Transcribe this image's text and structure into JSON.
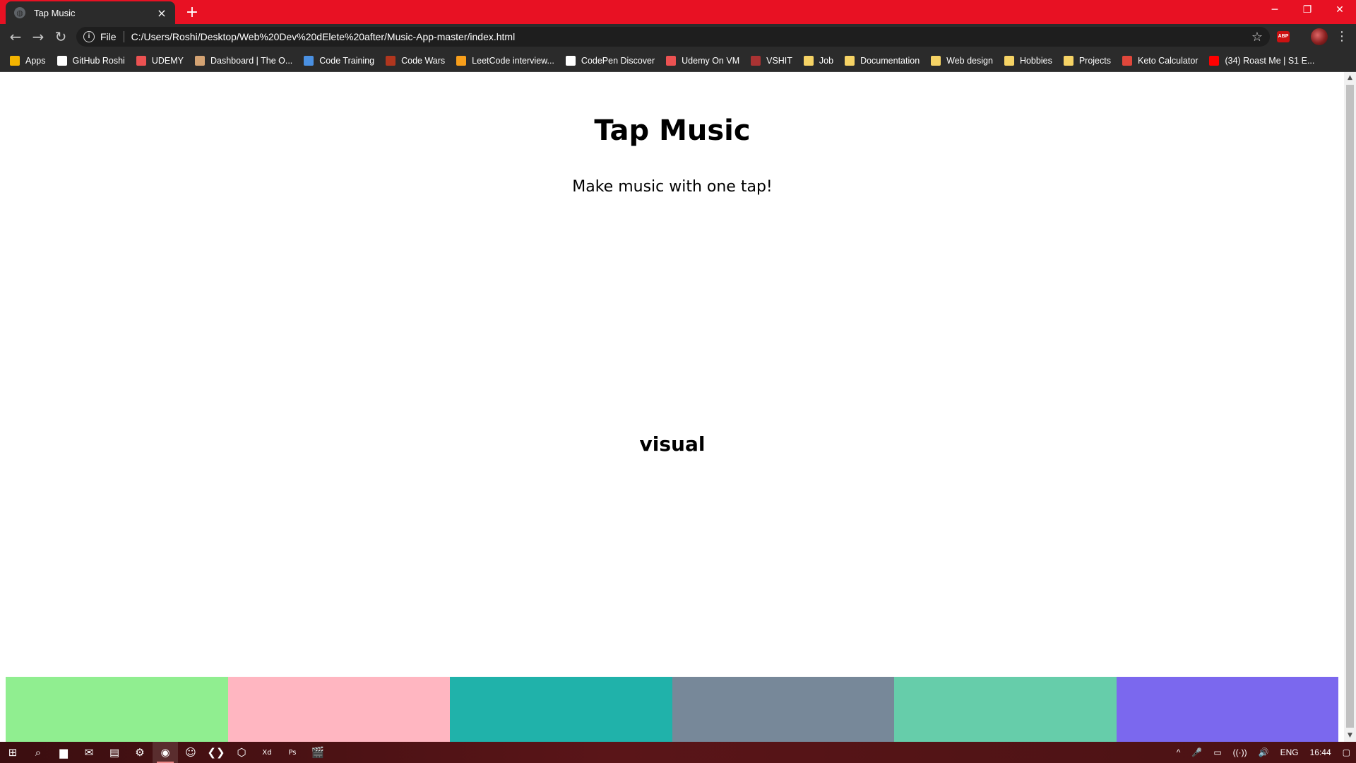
{
  "browser": {
    "tab_title": "Tap Music",
    "tab_close": "×",
    "new_tab": "+",
    "window_controls": {
      "minimize": "─",
      "restore": "❐",
      "close": "✕"
    },
    "nav": {
      "back": "←",
      "forward": "→",
      "reload": "↻"
    },
    "address": {
      "scheme_label": "File",
      "url": "C:/Users/Roshi/Desktop/Web%20Dev%20dElete%20after/Music-App-master/index.html"
    },
    "abp_label": "ABP",
    "menu": "⋮",
    "bookmarks": [
      {
        "label": "Apps",
        "icon": "apps-grid-icon",
        "color": "#f4b400"
      },
      {
        "label": "GitHub Roshi",
        "icon": "github-icon",
        "color": "#ffffff"
      },
      {
        "label": "UDEMY",
        "icon": "udemy-icon",
        "color": "#ec5252"
      },
      {
        "label": "Dashboard | The O...",
        "icon": "odin-icon",
        "color": "#d4a373"
      },
      {
        "label": "Code Training",
        "icon": "cloud-icon",
        "color": "#4a90e2"
      },
      {
        "label": "Code Wars",
        "icon": "codewars-icon",
        "color": "#b1361e"
      },
      {
        "label": "LeetCode interview...",
        "icon": "leetcode-icon",
        "color": "#f89f1b"
      },
      {
        "label": "CodePen Discover",
        "icon": "codepen-icon",
        "color": "#ffffff"
      },
      {
        "label": "Udemy On VM",
        "icon": "udemy-icon",
        "color": "#ec5252"
      },
      {
        "label": "VSHIT",
        "icon": "vshit-icon",
        "color": "#a33"
      },
      {
        "label": "Job",
        "icon": "folder-icon",
        "color": "#f6d365"
      },
      {
        "label": "Documentation",
        "icon": "folder-icon",
        "color": "#f6d365"
      },
      {
        "label": "Web design",
        "icon": "folder-icon",
        "color": "#f6d365"
      },
      {
        "label": "Hobbies",
        "icon": "folder-icon",
        "color": "#f6d365"
      },
      {
        "label": "Projects",
        "icon": "folder-icon",
        "color": "#f6d365"
      },
      {
        "label": "Keto Calculator",
        "icon": "keto-icon",
        "color": "#e0473b"
      },
      {
        "label": "(34) Roast Me | S1 E...",
        "icon": "youtube-icon",
        "color": "#ff0000"
      }
    ]
  },
  "page": {
    "title": "Tap Music",
    "subtitle": "Make music with one tap!",
    "visual_label": "visual",
    "pads": [
      {
        "name": "pad-1",
        "color": "#90ee90"
      },
      {
        "name": "pad-2",
        "color": "#ffb6c1"
      },
      {
        "name": "pad-3",
        "color": "#20b2aa"
      },
      {
        "name": "pad-4",
        "color": "#778899"
      },
      {
        "name": "pad-5",
        "color": "#66cdaa"
      },
      {
        "name": "pad-6",
        "color": "#7b68ee"
      }
    ]
  },
  "taskbar": {
    "items": [
      {
        "name": "start-button",
        "icon": "windows-icon",
        "glyph": "⊞"
      },
      {
        "name": "search-button",
        "icon": "search-icon",
        "glyph": "⌕"
      },
      {
        "name": "file-explorer",
        "icon": "folder-icon",
        "glyph": "▆"
      },
      {
        "name": "outlook",
        "icon": "mail-icon",
        "glyph": "✉"
      },
      {
        "name": "app-5",
        "icon": "app-icon",
        "glyph": "▤"
      },
      {
        "name": "steam",
        "icon": "steam-icon",
        "glyph": "⚙"
      },
      {
        "name": "chrome",
        "icon": "chrome-icon",
        "glyph": "◉",
        "active": true
      },
      {
        "name": "discord",
        "icon": "discord-icon",
        "glyph": "☺"
      },
      {
        "name": "vscode",
        "icon": "vscode-icon",
        "glyph": "❮❯"
      },
      {
        "name": "virtualbox",
        "icon": "cube-icon",
        "glyph": "⬡"
      },
      {
        "name": "adobe-xd",
        "icon": "xd-icon",
        "glyph": "Xd"
      },
      {
        "name": "photoshop",
        "icon": "ps-icon",
        "glyph": "Ps"
      },
      {
        "name": "clapper",
        "icon": "clapper-icon",
        "glyph": "🎬"
      }
    ],
    "tray": {
      "chevron": "^",
      "mic": "🎤",
      "battery": "▭",
      "wifi": "((·))",
      "volume": "🔊",
      "language": "ENG",
      "time": "16:44",
      "notifications": "▢"
    }
  }
}
